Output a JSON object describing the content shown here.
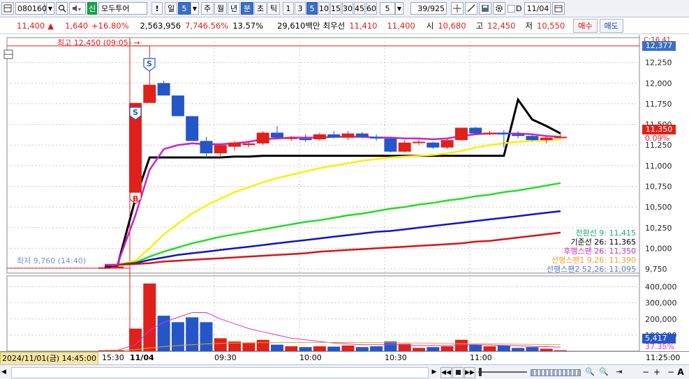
{
  "toolbar": {
    "code": "080160",
    "credit_badge": "신",
    "stock_name": "모두투어",
    "alert": "!",
    "period_day": "일",
    "interval_value": "5",
    "period_week": "주",
    "period_month": "월",
    "period_year": "년",
    "period_minute": "분",
    "period_second": "초",
    "period_tick": "틱",
    "intervals": [
      "1",
      "3",
      "5",
      "10",
      "15",
      "30",
      "45",
      "60"
    ],
    "selected_interval": "5",
    "count_value": "5",
    "page_count": "39/925",
    "checkbox_label": "D",
    "date": "11/04",
    "colors": {
      "selected": "#3b6fc2"
    }
  },
  "info": {
    "price": "11,400",
    "up_arrow": "▲",
    "change": "1,640",
    "change_pct": "+16.80%",
    "volume": "2,563,956",
    "volume_ratio": "7,746.56%",
    "turnover": "13.57%",
    "amount": "29,610백만",
    "best_ask_label": "최우선",
    "best_ask": "11,410",
    "best_bid": "11,400",
    "open_label": "시",
    "open": "10,680",
    "high_label": "고",
    "high": "12,450",
    "low_label": "저",
    "low": "10,550",
    "buy_label": "매수",
    "sell_label": "매도"
  },
  "annotations": {
    "high_marker": "최고 12,450 (09:05) →",
    "low_marker": "최저 9,760 (14:40)",
    "current_price_tag": "11,350",
    "current_pct_tag": "0.09%",
    "top_price_tag": "12,377",
    "top_hidden_tag": "C:16.41",
    "volume_tag": "5,417",
    "volume_pct_tag": "37.35%",
    "signal_s": "S",
    "signal_b": "B"
  },
  "legend": [
    {
      "text": "전환선 9: 11,415",
      "color": "#1aa77b"
    },
    {
      "text": "기준선 26: 11,365",
      "color": "#000000"
    },
    {
      "text": "후행스팬 26: 11,350",
      "color": "#c530c0"
    },
    {
      "text": "선행스팬1 9,26: 11,390",
      "color": "#f0a028"
    },
    {
      "text": "선행스팬2 52,26: 11,095",
      "color": "#5b79d6"
    }
  ],
  "x_axis": {
    "left_label": "2024/11/01(금) 14:45:00",
    "ticks": [
      "15:30",
      "11/04",
      "09:30",
      "10:00",
      "10:30",
      "11:00"
    ],
    "right_label": "11:25:00"
  },
  "chart_data": {
    "type": "candlestick",
    "price_axis": {
      "min": 9700,
      "max": 12500,
      "ticks": [
        9750,
        10000,
        10250,
        10500,
        10750,
        11000,
        11250,
        11500,
        11750,
        12000,
        12250
      ]
    },
    "volume_axis": {
      "min": 0,
      "max": 450000,
      "ticks": [
        100000,
        200000,
        300000,
        400000
      ]
    },
    "candles": [
      {
        "o": 9760,
        "h": 9780,
        "l": 9750,
        "c": 9770,
        "v": 5000
      },
      {
        "o": 9770,
        "h": 9790,
        "l": 9760,
        "c": 9780,
        "v": 8000
      },
      {
        "o": 10680,
        "h": 11750,
        "l": 10550,
        "c": 11760,
        "v": 140000
      },
      {
        "o": 11760,
        "h": 12450,
        "l": 11960,
        "c": 11980,
        "v": 420000
      },
      {
        "o": 12000,
        "h": 12030,
        "l": 11850,
        "c": 11850,
        "v": 220000
      },
      {
        "o": 11850,
        "h": 11850,
        "l": 11600,
        "c": 11600,
        "v": 180000
      },
      {
        "o": 11600,
        "h": 11600,
        "l": 11300,
        "c": 11300,
        "v": 210000
      },
      {
        "o": 11300,
        "h": 11350,
        "l": 11100,
        "c": 11150,
        "v": 180000
      },
      {
        "o": 11150,
        "h": 11250,
        "l": 11120,
        "c": 11250,
        "v": 80000
      },
      {
        "o": 11230,
        "h": 11300,
        "l": 11180,
        "c": 11280,
        "v": 60000
      },
      {
        "o": 11250,
        "h": 11300,
        "l": 11220,
        "c": 11270,
        "v": 50000
      },
      {
        "o": 11270,
        "h": 11420,
        "l": 11250,
        "c": 11400,
        "v": 70000
      },
      {
        "o": 11400,
        "h": 11480,
        "l": 11330,
        "c": 11340,
        "v": 40000
      },
      {
        "o": 11330,
        "h": 11360,
        "l": 11300,
        "c": 11340,
        "v": 30000
      },
      {
        "o": 11330,
        "h": 11380,
        "l": 11290,
        "c": 11310,
        "v": 25000
      },
      {
        "o": 11320,
        "h": 11400,
        "l": 11300,
        "c": 11380,
        "v": 30000
      },
      {
        "o": 11380,
        "h": 11420,
        "l": 11330,
        "c": 11340,
        "v": 28000
      },
      {
        "o": 11340,
        "h": 11420,
        "l": 11310,
        "c": 11390,
        "v": 35000
      },
      {
        "o": 11390,
        "h": 11410,
        "l": 11330,
        "c": 11350,
        "v": 25000
      },
      {
        "o": 11350,
        "h": 11380,
        "l": 11300,
        "c": 11330,
        "v": 30000
      },
      {
        "o": 11330,
        "h": 11340,
        "l": 11160,
        "c": 11170,
        "v": 60000
      },
      {
        "o": 11170,
        "h": 11310,
        "l": 11160,
        "c": 11280,
        "v": 45000
      },
      {
        "o": 11280,
        "h": 11320,
        "l": 11250,
        "c": 11290,
        "v": 20000
      },
      {
        "o": 11280,
        "h": 11290,
        "l": 11200,
        "c": 11220,
        "v": 25000
      },
      {
        "o": 11220,
        "h": 11330,
        "l": 11200,
        "c": 11310,
        "v": 30000
      },
      {
        "o": 11310,
        "h": 11460,
        "l": 11300,
        "c": 11460,
        "v": 70000
      },
      {
        "o": 11460,
        "h": 11470,
        "l": 11380,
        "c": 11390,
        "v": 40000
      },
      {
        "o": 11390,
        "h": 11420,
        "l": 11370,
        "c": 11400,
        "v": 30000
      },
      {
        "o": 11400,
        "h": 11430,
        "l": 11220,
        "c": 11380,
        "v": 35000
      },
      {
        "o": 11380,
        "h": 11420,
        "l": 11330,
        "c": 11360,
        "v": 20000
      },
      {
        "o": 11360,
        "h": 11380,
        "l": 11300,
        "c": 11310,
        "v": 25000
      },
      {
        "o": 11310,
        "h": 11370,
        "l": 11270,
        "c": 11340,
        "v": 15000
      },
      {
        "o": 11350,
        "h": 11380,
        "l": 11330,
        "c": 11350,
        "v": 5417
      }
    ],
    "series": [
      {
        "name": "전환선 9",
        "color": "#000000",
        "values": [
          9780,
          9780,
          10600,
          11100,
          11100,
          11100,
          11100,
          11100,
          11100,
          11110,
          11110,
          11120,
          11120,
          11120,
          11120,
          11120,
          11120,
          11120,
          11120,
          11120,
          11120,
          11120,
          11120,
          11120,
          11120,
          11120,
          11120,
          11120,
          11120,
          11800,
          11560,
          11480,
          11390
        ]
      },
      {
        "name": "선행스팬1",
        "color": "#ffee00",
        "values": [
          9790,
          9800,
          9850,
          10000,
          10170,
          10300,
          10420,
          10520,
          10600,
          10680,
          10740,
          10800,
          10850,
          10890,
          10930,
          10970,
          11000,
          11030,
          11060,
          11080,
          11100,
          11110,
          11120,
          11130,
          11150,
          11180,
          11220,
          11250,
          11270,
          11290,
          11300,
          11310,
          11320
        ]
      },
      {
        "name": "선행스팬2",
        "color": "#22dd22",
        "values": [
          9790,
          9800,
          9830,
          9900,
          9960,
          10010,
          10060,
          10100,
          10140,
          10170,
          10200,
          10230,
          10260,
          10290,
          10320,
          10340,
          10370,
          10400,
          10420,
          10450,
          10480,
          10500,
          10530,
          10550,
          10580,
          10600,
          10630,
          10650,
          10680,
          10700,
          10730,
          10760,
          10790
        ]
      },
      {
        "name": "파랑",
        "color": "#1111cc",
        "values": [
          9790,
          9800,
          9820,
          9860,
          9890,
          9920,
          9940,
          9960,
          9980,
          10000,
          10020,
          10040,
          10060,
          10080,
          10100,
          10120,
          10140,
          10160,
          10180,
          10200,
          10210,
          10230,
          10250,
          10270,
          10290,
          10310,
          10330,
          10350,
          10370,
          10390,
          10410,
          10430,
          10450
        ]
      },
      {
        "name": "빨강",
        "color": "#dd1111",
        "values": [
          9800,
          9800,
          9810,
          9820,
          9840,
          9850,
          9860,
          9870,
          9880,
          9890,
          9900,
          9910,
          9920,
          9930,
          9940,
          9960,
          9970,
          9980,
          9990,
          10000,
          10010,
          10020,
          10030,
          10040,
          10050,
          10060,
          10080,
          10090,
          10110,
          10130,
          10150,
          10170,
          10190
        ]
      },
      {
        "name": "후행스팬 26",
        "color": "#cc22cc",
        "values": [
          9800,
          9800,
          10400,
          10950,
          11200,
          11250,
          11270,
          11260,
          11260,
          11270,
          11290,
          11320,
          11330,
          11340,
          11340,
          11340,
          11350,
          11350,
          11350,
          11340,
          11340,
          11330,
          11330,
          11320,
          11330,
          11360,
          11380,
          11390,
          11390,
          11390,
          11380,
          11360,
          11350
        ]
      }
    ],
    "volume_ma": {
      "name": "volume MA",
      "color": "#d633d6",
      "values": [
        5000,
        6000,
        40000,
        130000,
        180000,
        210000,
        240000,
        240000,
        200000,
        170000,
        140000,
        120000,
        100000,
        80000,
        70000,
        60000,
        50000,
        45000,
        40000,
        40000,
        40000,
        40000,
        35000,
        35000,
        35000,
        40000,
        40000,
        38000,
        35000,
        33000,
        30000,
        28000,
        25000
      ]
    },
    "volume_ma2": {
      "name": "volume MA2",
      "color": "#f0a028",
      "values": [
        5000,
        5000,
        10000,
        20000,
        28000,
        34000,
        40000,
        45000,
        48000,
        50000,
        52000,
        53000,
        54000,
        54000,
        54000,
        54000,
        54000,
        54000,
        54000,
        53000,
        52000,
        51000,
        50000,
        49000,
        48000,
        47000,
        46000,
        45000,
        44000,
        43000,
        42000,
        41000,
        40000
      ]
    }
  }
}
